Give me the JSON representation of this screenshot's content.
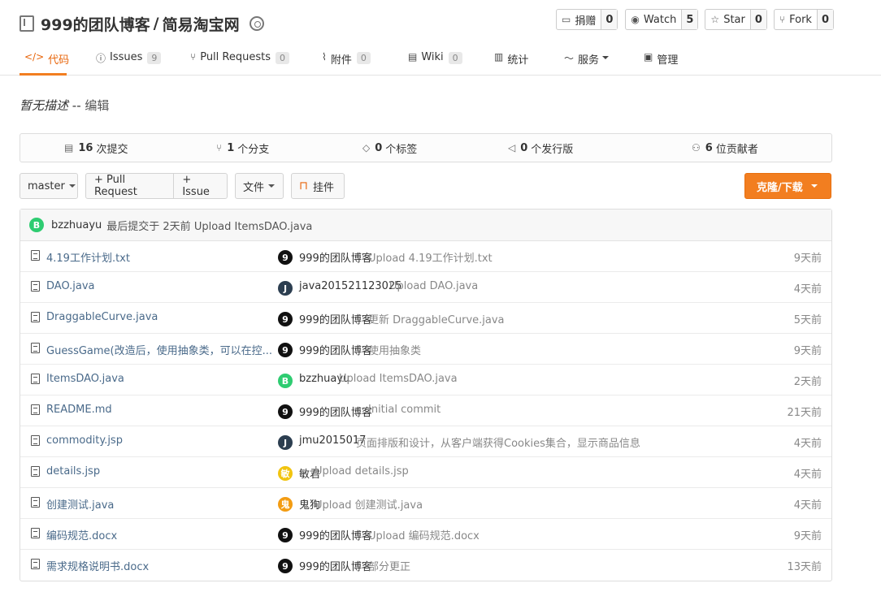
{
  "repo": {
    "owner": "999的团队博客",
    "separator": "/",
    "name": "简易淘宝网"
  },
  "actions": [
    {
      "label": "捐赠",
      "count": "0",
      "icon": "donate-icon",
      "glyph": "▭"
    },
    {
      "label": "Watch",
      "count": "5",
      "icon": "eye-icon",
      "glyph": "◉"
    },
    {
      "label": "Star",
      "count": "0",
      "icon": "star-icon",
      "glyph": "☆"
    },
    {
      "label": "Fork",
      "count": "0",
      "icon": "fork-icon",
      "glyph": "⑂"
    }
  ],
  "tabs": [
    {
      "label": "代码",
      "icon": "code-icon",
      "glyph": "</>",
      "count": "",
      "active": true
    },
    {
      "label": "Issues",
      "icon": "issues-icon",
      "glyph": "ⓘ",
      "count": "9"
    },
    {
      "label": "Pull Requests",
      "icon": "pull-request-icon",
      "glyph": "⑂",
      "count": "0"
    },
    {
      "label": "附件",
      "icon": "paperclip-icon",
      "glyph": "⌇",
      "count": "0"
    },
    {
      "label": "Wiki",
      "icon": "book-icon",
      "glyph": "▤",
      "count": "0"
    },
    {
      "label": "统计",
      "icon": "bar-chart-icon",
      "glyph": "▥",
      "count": ""
    },
    {
      "label": "服务",
      "icon": "pulse-icon",
      "glyph": "〜",
      "count": ""
    },
    {
      "label": "管理",
      "icon": "settings-doc-icon",
      "glyph": "▣",
      "count": ""
    }
  ],
  "description": {
    "text": "暂无描述",
    "sep": "--",
    "edit": "编辑"
  },
  "stats": [
    {
      "count": "16",
      "label": "次提交",
      "icon": "commits-icon",
      "glyph": "▤"
    },
    {
      "count": "1",
      "label": "个分支",
      "icon": "branch-icon",
      "glyph": "⑂"
    },
    {
      "count": "0",
      "label": "个标签",
      "icon": "tag-icon",
      "glyph": "◇"
    },
    {
      "count": "0",
      "label": "个发行版",
      "icon": "release-icon",
      "glyph": "◁"
    },
    {
      "count": "6",
      "label": "位贡献者",
      "icon": "contributors-icon",
      "glyph": "⚇"
    }
  ],
  "toolbar": {
    "branch": "master",
    "pull_request": "+ Pull Request",
    "issue": "+ Issue",
    "file": "文件",
    "widget": "挂件",
    "clone": "克隆/下载"
  },
  "last_commit": {
    "avatar": "B",
    "avatar_color": "#2ecc71",
    "user": "bzzhuayu",
    "text": "最后提交于 2天前 Upload ItemsDAO.java"
  },
  "files": [
    {
      "name": "4.19工作计划.txt",
      "avatar": "9",
      "color": "#111111",
      "author": "999的团队博客",
      "message": "Upload 4.19工作计划.txt",
      "time": "9天前"
    },
    {
      "name": "DAO.java",
      "avatar": "J",
      "color": "#2c3e50",
      "author": "java201521123025",
      "message": "Upload DAO.java",
      "time": "4天前"
    },
    {
      "name": "DraggableCurve.java",
      "avatar": "9",
      "color": "#111111",
      "author": "999的团队博客",
      "message": "更新 DraggableCurve.java",
      "time": "5天前"
    },
    {
      "name": "GuessGame(改造后，使用抽象类，可以在控...",
      "avatar": "9",
      "color": "#111111",
      "author": "999的团队博客",
      "message": "使用抽象类",
      "time": "9天前"
    },
    {
      "name": "ItemsDAO.java",
      "avatar": "B",
      "color": "#2ecc71",
      "author": "bzzhuayu",
      "message": "Upload ItemsDAO.java",
      "time": "2天前"
    },
    {
      "name": "README.md",
      "avatar": "9",
      "color": "#111111",
      "author": "999的团队博客",
      "message": "Initial commit",
      "time": "21天前"
    },
    {
      "name": "commodity.jsp",
      "avatar": "J",
      "color": "#2c3e50",
      "author": "jmu2015017",
      "message": "页面排版和设计，从客户端获得Cookies集合，显示商品信息",
      "time": "4天前"
    },
    {
      "name": "details.jsp",
      "avatar": "敏",
      "color": "#f1c40f",
      "author": "敏君",
      "message": "Upload details.jsp",
      "time": "4天前"
    },
    {
      "name": "创建测试.java",
      "avatar": "鬼",
      "color": "#f39c12",
      "author": "鬼狗",
      "message": "Upload 创建测试.java",
      "time": "4天前"
    },
    {
      "name": "编码规范.docx",
      "avatar": "9",
      "color": "#111111",
      "author": "999的团队博客",
      "message": "Upload 编码规范.docx",
      "time": "9天前"
    },
    {
      "name": "需求规格说明书.docx",
      "avatar": "9",
      "color": "#111111",
      "author": "999的团队博客",
      "message": "部分更正",
      "time": "13天前"
    }
  ]
}
